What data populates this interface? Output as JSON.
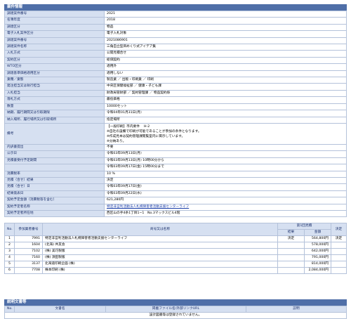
{
  "project_section": {
    "title": "案件情報",
    "rows": [
      {
        "label": "調達案件番号",
        "value": "2021"
      },
      {
        "label": "名簿年度",
        "value": "2018"
      },
      {
        "label": "調達区分",
        "value": "物品"
      },
      {
        "label": "電子入札案件区分",
        "value": "電子入札対象"
      },
      {
        "label": "調達案件番号",
        "value": "2021086901"
      },
      {
        "label": "調達案件名称",
        "value": "三角自立型目めくり式アイデア集"
      },
      {
        "label": "入札方式",
        "value": "公開見積合せ"
      },
      {
        "label": "契約区分",
        "value": "総価契約"
      },
      {
        "label": "WTO区分",
        "value": "適用外"
      },
      {
        "label": "調達基準価格適用区分",
        "value": "適用しない"
      },
      {
        "label": "業種／業態",
        "value": "製造業 ／ 出版・印刷業 ／ 印刷"
      },
      {
        "label": "発注担当又は執行担当",
        "value": "中央区保健福祉部 ／ 健康・子ども課"
      },
      {
        "label": "入札担当",
        "value": "財政局管財部 ／ 契約管理課 ／ 物品契約係"
      },
      {
        "label": "落札方式",
        "value": "最低価格"
      },
      {
        "label": "数量",
        "value": "10000セット"
      },
      {
        "label": "納期、履行期間又は引取期限",
        "value": "令和04年01月31日(月)"
      },
      {
        "label": "納入場所、履行場所又は引取場所",
        "value": "指定場所"
      }
    ],
    "notes": {
      "label": "備考",
      "lines": [
        "【一般印刷】市内要件 　H-2",
        "※自社の設備で印刷が可能であることが参加の条件となります。",
        "※作成見本は契約管理課閲覧室内に掲示しています。",
        "※分納あり。"
      ]
    },
    "rows2": [
      {
        "label": "内訳書提出",
        "value": "不要"
      },
      {
        "label": "公示日",
        "value": "令和03年09月13日(月)"
      },
      {
        "label": "見積書受付予定期間",
        "value": "令和03年09月13日(月) 10時00分から"
      },
      {
        "label": "",
        "value": "令和03年09月17日(金) 15時00分まで"
      },
      {
        "label": "消費税率",
        "value": "10 %"
      },
      {
        "label": "見積（合せ）結果",
        "value": "決定"
      },
      {
        "label": "見積（合せ）日",
        "value": "令和03年09月17日(金)"
      },
      {
        "label": "結果発表日",
        "value": "令和03年09月22日(水)"
      },
      {
        "label": "契約予定金額（消費税等を含む）",
        "value": "621,280円"
      },
      {
        "label": "契約予定者名称",
        "value": "特定非営利活動法人札幌障害者活動支援センターライフ",
        "link": true
      },
      {
        "label": "契約予定者所在地",
        "value": "西区山の手4条1丁目1−1　No.3マックスビル4階"
      }
    ]
  },
  "bids": {
    "headers": {
      "no": "No.",
      "participant_no": "参加業者番号",
      "name": "商号又は名称",
      "round1": "第1回見積",
      "result": "結果",
      "amount": "金額",
      "decision": "決定"
    },
    "rows": [
      {
        "no": "1",
        "pnum": "7991",
        "name": "特定非営利活動法人札幌障害者活動支援センターライフ",
        "result": "決定",
        "amount": "564,800円",
        "decision": "決定"
      },
      {
        "no": "2",
        "pnum": "1604",
        "name": "(北海) 共友会",
        "result": "",
        "amount": "578,000円",
        "decision": ""
      },
      {
        "no": "3",
        "pnum": "7102",
        "name": "(株) 美巧製版",
        "result": "",
        "amount": "642,000円",
        "decision": ""
      },
      {
        "no": "4",
        "pnum": "7160",
        "name": "(株) 須田製版",
        "result": "",
        "amount": "791,000円",
        "decision": ""
      },
      {
        "no": "5",
        "pnum": "3137",
        "name": "北海道印刷企画 (株)",
        "result": "",
        "amount": "814,000円",
        "decision": ""
      },
      {
        "no": "6",
        "pnum": "7708",
        "name": "株本印刷 (株)",
        "result": "",
        "amount": "2,084,000円",
        "decision": ""
      }
    ]
  },
  "docs_section": {
    "title": "説明文書等",
    "headers": {
      "no": "No.",
      "doc_name": "文書名",
      "file_link": "掲載ファイル名/外部リンクURL",
      "desc": "説明"
    },
    "empty_message": "設計図書等は登録されていません。"
  }
}
